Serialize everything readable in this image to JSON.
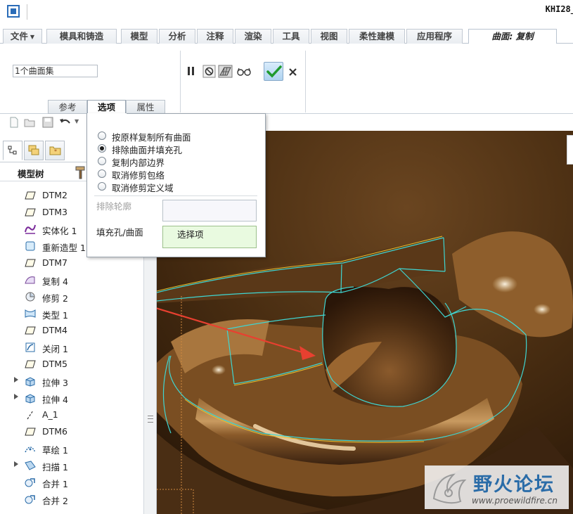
{
  "window": {
    "title": "KHI28_"
  },
  "ribbon": {
    "tabs": [
      {
        "label": "文件",
        "has_dropdown": true
      },
      {
        "label": "模具和铸造"
      },
      {
        "label": "模型"
      },
      {
        "label": "分析"
      },
      {
        "label": "注释"
      },
      {
        "label": "渲染"
      },
      {
        "label": "工具"
      },
      {
        "label": "视图"
      },
      {
        "label": "柔性建模"
      },
      {
        "label": "应用程序"
      },
      {
        "label": "曲面: 复制",
        "active": true
      }
    ],
    "collector_value": "1个曲面集",
    "subtabs": [
      {
        "label": "参考"
      },
      {
        "label": "选项",
        "active": true
      },
      {
        "label": "属性"
      }
    ],
    "icons": [
      "pause-icon",
      "stop-icon",
      "preview-mesh-icon",
      "glasses-preview-icon",
      "ok-check-icon",
      "cancel-x-icon"
    ]
  },
  "options_popup": {
    "radios": [
      {
        "label": "按原样复制所有曲面",
        "selected": false
      },
      {
        "label": "排除曲面并填充孔",
        "selected": true
      },
      {
        "label": "复制内部边界",
        "selected": false
      },
      {
        "label": "取消修剪包络",
        "selected": false
      },
      {
        "label": "取消修剪定义域",
        "selected": false
      }
    ],
    "exclude_contour_label": "排除轮廓",
    "fill_holes_label": "填充孔/曲面",
    "fill_holes_value": "选择项"
  },
  "model_tree": {
    "header": "模型树",
    "items": [
      {
        "label": "DTM2",
        "icon": "datum-plane-icon",
        "expandable": false
      },
      {
        "label": "DTM3",
        "icon": "datum-plane-icon",
        "expandable": false
      },
      {
        "label": "实体化 1",
        "icon": "solidify-icon",
        "expandable": false
      },
      {
        "label": "重新造型 1",
        "icon": "restyle-icon",
        "expandable": false
      },
      {
        "label": "DTM7",
        "icon": "datum-plane-icon",
        "expandable": false
      },
      {
        "label": "复制 4",
        "icon": "copy-surface-icon",
        "expandable": false
      },
      {
        "label": "修剪 2",
        "icon": "trim-icon",
        "expandable": false
      },
      {
        "label": "类型 1",
        "icon": "style-icon",
        "expandable": false
      },
      {
        "label": "DTM4",
        "icon": "datum-plane-icon",
        "expandable": false
      },
      {
        "label": "关闭 1",
        "icon": "close-surface-icon",
        "expandable": false
      },
      {
        "label": "DTM5",
        "icon": "datum-plane-icon",
        "expandable": false
      },
      {
        "label": "拉伸 3",
        "icon": "extrude-icon",
        "expandable": true
      },
      {
        "label": "拉伸 4",
        "icon": "extrude-icon",
        "expandable": true
      },
      {
        "label": "A_1",
        "icon": "datum-axis-icon",
        "expandable": false
      },
      {
        "label": "DTM6",
        "icon": "datum-plane-icon",
        "expandable": false
      },
      {
        "label": "草绘 1",
        "icon": "sketch-icon",
        "expandable": false
      },
      {
        "label": "扫描 1",
        "icon": "sweep-icon",
        "expandable": true
      },
      {
        "label": "合并 1",
        "icon": "merge-icon",
        "expandable": false
      },
      {
        "label": "合并 2",
        "icon": "merge-icon",
        "expandable": false
      }
    ]
  },
  "watermark": {
    "title": "野火论坛",
    "url": "www.proewildfire.cn"
  },
  "colors": {
    "accent": "#2a6cb8",
    "surface_edge": "#3fd6d2",
    "highlight_edge": "#e8c030",
    "arrow": "#e84030"
  }
}
